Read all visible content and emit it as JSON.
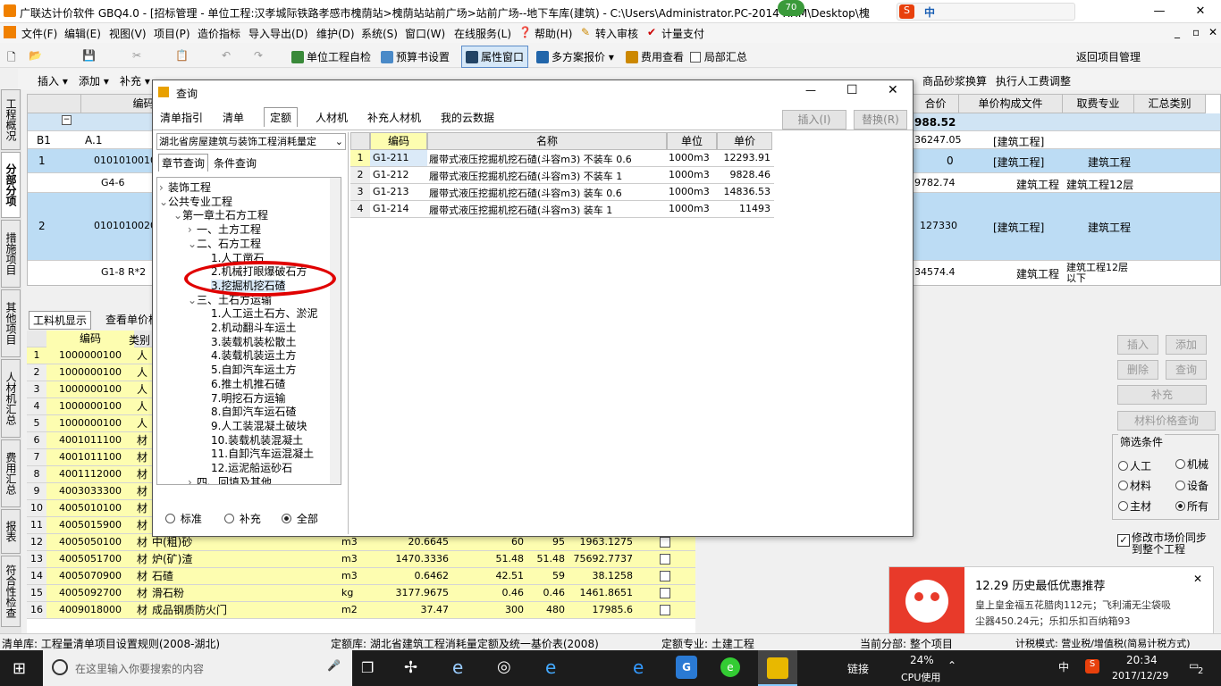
{
  "window": {
    "title": "广联达计价软件 GBQ4.0 - [招标管理 - 单位工程:汉孝城际铁路孝感市槐荫站>槐荫站站前广场>站前广场--地下车库(建筑) - C:\\Users\\Administrator.PC-2014      RHM\\Desktop\\槐",
    "badge": "70",
    "ime": "中"
  },
  "menu": [
    "文件(F)",
    "编辑(E)",
    "视图(V)",
    "项目(P)",
    "造价指标",
    "导入导出(D)",
    "维护(D)",
    "系统(S)",
    "窗口(W)",
    "在线服务(L)",
    "帮助(H)",
    "转入审核",
    "计量支付"
  ],
  "toolbar1": [
    "单位工程自检",
    "预算书设置",
    "属性窗口",
    "多方案报价",
    "费用查看",
    "局部汇总",
    "返回项目管理"
  ],
  "toolbar2": [
    "插入",
    "添加",
    "补充",
    "商品砂浆换算",
    "执行人工费调整"
  ],
  "vtabs": [
    "工程概况",
    "分部分项",
    "措施项目",
    "其他项目",
    "人材机汇总",
    "费用汇总",
    "报表",
    "符合性检查"
  ],
  "main_grid": {
    "headers": {
      "code": "编码",
      "total_price": "合价",
      "doc": "单价构成文件",
      "fee": "取费专业",
      "sum": "汇总类别"
    },
    "total": "988.52",
    "rows": [
      {
        "no": "B1",
        "code": "A.1",
        "price": "36247.05",
        "doc": "[建筑工程]",
        "fee": ""
      },
      {
        "no": "1",
        "code": "010101001001",
        "price": "0",
        "doc": "[建筑工程]",
        "fee": "建筑工程"
      },
      {
        "no": "",
        "code": "G4-6",
        "price": "9782.74",
        "doc": "建筑工程",
        "fee": "建筑工程12层"
      },
      {
        "no": "2",
        "code": "010101002001",
        "price": "127330",
        "doc": "[建筑工程]",
        "fee": "建筑工程"
      },
      {
        "no": "",
        "code": "G1-8 R*2",
        "price": "34574.4",
        "doc": "建筑工程",
        "fee": "建筑工程12层以下"
      }
    ]
  },
  "bottom_tabs": [
    "工料机显示",
    "查看单价构"
  ],
  "bottom_grid": {
    "headers": {
      "code": "编码",
      "type": "类别"
    },
    "rows": [
      {
        "no": "1",
        "code": "1000000100",
        "type": "人",
        "name": "",
        "unit": "",
        "qty": "",
        "p1": "",
        "p2": "",
        "sum": ""
      },
      {
        "no": "2",
        "code": "1000000100",
        "type": "人",
        "name": "",
        "unit": "",
        "qty": "",
        "p1": "",
        "p2": "",
        "sum": ""
      },
      {
        "no": "3",
        "code": "1000000100",
        "type": "人",
        "name": "",
        "unit": "",
        "qty": "",
        "p1": "",
        "p2": "",
        "sum": ""
      },
      {
        "no": "4",
        "code": "1000000100",
        "type": "人",
        "name": "",
        "unit": "",
        "qty": "",
        "p1": "",
        "p2": "",
        "sum": ""
      },
      {
        "no": "5",
        "code": "1000000100",
        "type": "人",
        "name": "",
        "unit": "",
        "qty": "",
        "p1": "",
        "p2": "",
        "sum": ""
      },
      {
        "no": "6",
        "code": "4001011100",
        "type": "材",
        "name": "",
        "unit": "",
        "qty": "",
        "p1": "",
        "p2": "",
        "sum": ""
      },
      {
        "no": "7",
        "code": "4001011100",
        "type": "材",
        "name": "",
        "unit": "",
        "qty": "",
        "p1": "",
        "p2": "",
        "sum": ""
      },
      {
        "no": "8",
        "code": "4001112000",
        "type": "材",
        "name": "",
        "unit": "",
        "qty": "",
        "p1": "",
        "p2": "",
        "sum": ""
      },
      {
        "no": "9",
        "code": "4003033300",
        "type": "材",
        "name": "",
        "unit": "",
        "qty": "",
        "p1": "",
        "p2": "",
        "sum": ""
      },
      {
        "no": "10",
        "code": "4005010100",
        "type": "材",
        "name": "",
        "unit": "",
        "qty": "",
        "p1": "",
        "p2": "",
        "sum": ""
      },
      {
        "no": "11",
        "code": "4005015900",
        "type": "材",
        "name": "",
        "unit": "",
        "qty": "",
        "p1": "",
        "p2": "",
        "sum": ""
      },
      {
        "no": "12",
        "code": "4005050100",
        "type": "材",
        "name": "中(粗)砂",
        "unit": "m3",
        "qty": "20.6645",
        "p1": "60",
        "p2": "95",
        "sum": "1963.1275"
      },
      {
        "no": "13",
        "code": "4005051700",
        "type": "材",
        "name": "炉(矿)渣",
        "unit": "m3",
        "qty": "1470.3336",
        "p1": "51.48",
        "p2": "51.48",
        "sum": "75692.7737"
      },
      {
        "no": "14",
        "code": "4005070900",
        "type": "材",
        "name": "石碴",
        "unit": "m3",
        "qty": "0.6462",
        "p1": "42.51",
        "p2": "59",
        "sum": "38.1258"
      },
      {
        "no": "15",
        "code": "4005092700",
        "type": "材",
        "name": "滑石粉",
        "unit": "kg",
        "qty": "3177.9675",
        "p1": "0.46",
        "p2": "0.46",
        "sum": "1461.8651"
      },
      {
        "no": "16",
        "code": "4009018000",
        "type": "材",
        "name": "成品钢质防火门",
        "unit": "m2",
        "qty": "37.47",
        "p1": "300",
        "p2": "480",
        "sum": "17985.6"
      }
    ]
  },
  "right_panel": {
    "insert": "插入",
    "add": "添加",
    "delete": "删除",
    "query": "查询",
    "supplement": "补充",
    "price_query": "材料价格查询",
    "filter_title": "筛选条件",
    "filters": [
      "人工",
      "机械",
      "材料",
      "设备",
      "主材",
      "所有"
    ],
    "sync": "修改市场价同步到整个工程"
  },
  "dialog": {
    "title": "查询",
    "tabs": [
      "清单指引",
      "清单",
      "定额",
      "人材机",
      "补充人材机",
      "我的云数据"
    ],
    "insert_btn": "插入(I)",
    "replace_btn": "替换(R)",
    "library": "湖北省房屋建筑与装饰工程消耗量定",
    "subtabs": [
      "章节查询",
      "条件查询"
    ],
    "tree": [
      "装饰工程",
      "公共专业工程",
      "第一章土石方工程",
      "一、土方工程",
      "二、石方工程",
      "1.人工凿石",
      "2.机械打眼爆破石方",
      "3.挖掘机挖石碴",
      "三、土石方运输",
      "1.人工运土石方、淤泥",
      "2.机动翻斗车运土",
      "3.装载机装松散土",
      "4.装载机装运土方",
      "5.自卸汽车运土方",
      "6.推土机推石碴",
      "7.明挖石方运输",
      "8.自卸汽车运石碴",
      "9.人工装混凝土破块",
      "10.装载机装混凝土",
      "11.自卸汽车运混凝土",
      "12.运泥船运砂石",
      "四、回填及其他"
    ],
    "radios": [
      "标准",
      "补充",
      "全部"
    ],
    "table_headers": {
      "code": "编码",
      "name": "名称",
      "unit": "单位",
      "price": "单价"
    },
    "rows": [
      {
        "no": "1",
        "code": "G1-211",
        "name": "履带式液压挖掘机挖石碴(斗容m3) 不装车 0.6",
        "unit": "1000m3",
        "price": "12293.91"
      },
      {
        "no": "2",
        "code": "G1-212",
        "name": "履带式液压挖掘机挖石碴(斗容m3) 不装车 1",
        "unit": "1000m3",
        "price": "9828.46"
      },
      {
        "no": "3",
        "code": "G1-213",
        "name": "履带式液压挖掘机挖石碴(斗容m3) 装车 0.6",
        "unit": "1000m3",
        "price": "14836.53"
      },
      {
        "no": "4",
        "code": "G1-214",
        "name": "履带式液压挖掘机挖石碴(斗容m3) 装车 1",
        "unit": "1000m3",
        "price": "11493"
      }
    ]
  },
  "popup": {
    "title": "12.29 历史最低优惠推荐",
    "line1": "皇上皇金福五花腊肉112元；飞利浦无尘袋吸",
    "line2": "尘器450.24元；乐扣乐扣百纳箱93"
  },
  "status": [
    "清单库: 工程量清单项目设置规则(2008-湖北)",
    "定额库: 湖北省建筑工程消耗量定额及统一基价表(2008)",
    "定额专业: 土建工程",
    "当前分部: 整个项目",
    "计税模式: 营业税/增值税(简易计税方式)"
  ],
  "taskbar": {
    "search": "在这里输入你要搜索的内容",
    "link": "链接",
    "cpu": "24%",
    "cpu_label": "CPU使用",
    "ime": "中",
    "time": "20:34",
    "date": "2017/12/29",
    "notif": "2"
  },
  "colors": {
    "accent_blue": "#bcdcf4",
    "yellow": "#fdfdb0",
    "red": "#e00000"
  }
}
